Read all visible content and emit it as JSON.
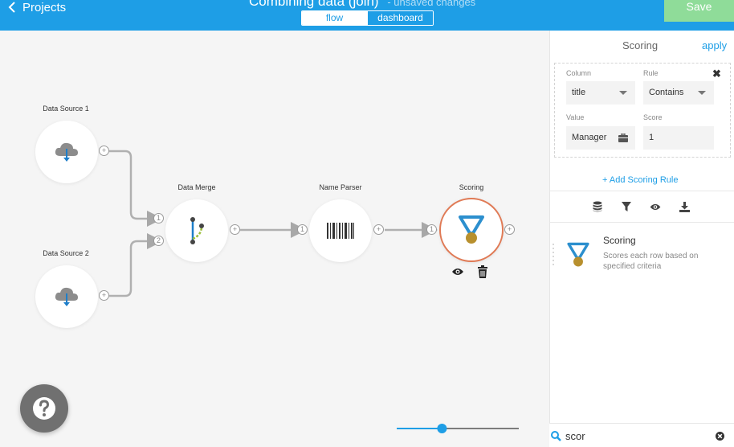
{
  "header": {
    "back_label": "Projects",
    "title": "Combining data (join)",
    "status": "- unsaved changes",
    "tabs": [
      {
        "label": "flow",
        "active": true
      },
      {
        "label": "dashboard",
        "active": false
      }
    ],
    "save_label": "Save"
  },
  "colors": {
    "brand_blue": "#1e9ee6",
    "save_green": "#8fdc99",
    "selected_ring": "#e07a55",
    "medal_gold": "#b8902e",
    "medal_blue": "#2c8fce"
  },
  "canvas": {
    "nodes": [
      {
        "id": "ds1",
        "label": "Data Source 1",
        "icon": "cloud-download-icon"
      },
      {
        "id": "ds2",
        "label": "Data Source 2",
        "icon": "cloud-download-icon"
      },
      {
        "id": "merge",
        "label": "Data Merge",
        "icon": "merge-icon"
      },
      {
        "id": "parser",
        "label": "Name Parser",
        "icon": "barcode-icon"
      },
      {
        "id": "scoring",
        "label": "Scoring",
        "icon": "medal-icon",
        "selected": true
      }
    ],
    "port_labels": {
      "in1": "1",
      "in2": "2",
      "plus": "+"
    },
    "zoom_level": 0.36
  },
  "panel": {
    "title": "Scoring",
    "apply_label": "apply",
    "rule": {
      "column_label": "Column",
      "column_value": "title",
      "rule_label": "Rule",
      "rule_value": "Contains",
      "value_label": "Value",
      "value_value": "Manager",
      "score_label": "Score",
      "score_value": "1"
    },
    "add_rule_label": "+ Add Scoring Rule",
    "tools": [
      "database-icon",
      "filter-icon",
      "eye-icon",
      "download-icon"
    ],
    "result": {
      "name": "Scoring",
      "description": "Scores each row based on specified criteria"
    }
  },
  "search": {
    "value": "scor",
    "placeholder": ""
  }
}
